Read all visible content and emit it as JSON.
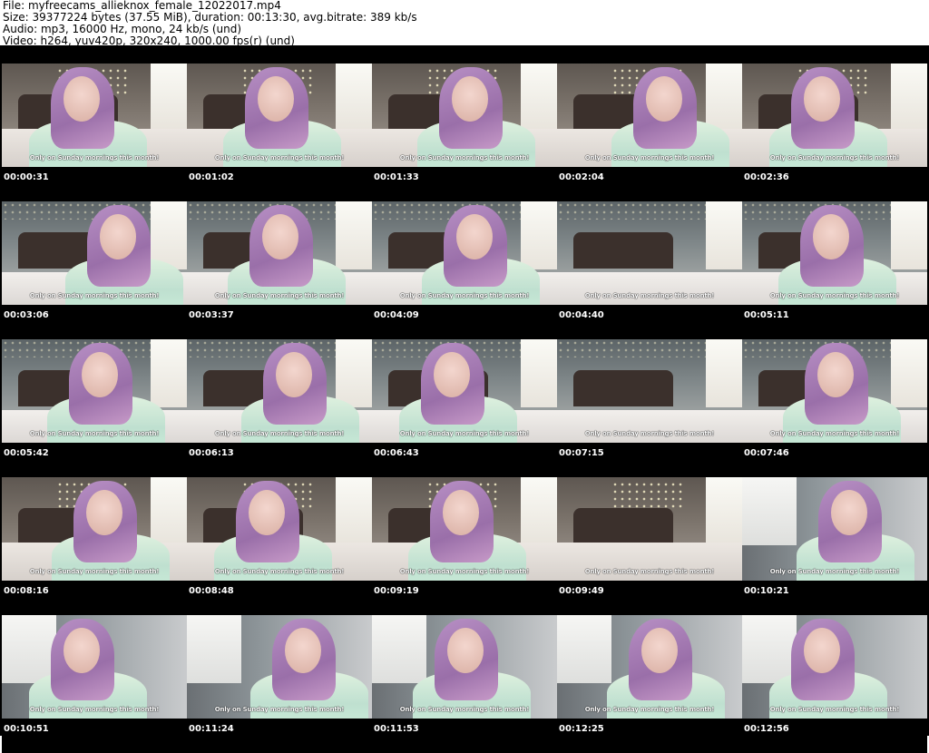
{
  "header": {
    "line1": "File: myfreecams_allieknox_female_12022017.mp4",
    "line2": "Size: 39377224 bytes (37.55 MiB), duration: 00:13:30, avg.bitrate: 389 kb/s",
    "line3": "Audio: mp3, 16000 Hz, mono, 24 kb/s (und)",
    "line4": "Video: h264, yuv420p, 320x240, 1000.00 fps(r) (und)"
  },
  "caption": "Only on Sunday mornings this month!",
  "thumbnails": [
    {
      "time": "00:00:31",
      "scene": "bedroom-a"
    },
    {
      "time": "00:01:02",
      "scene": "bedroom-a"
    },
    {
      "time": "00:01:33",
      "scene": "bedroom-a"
    },
    {
      "time": "00:02:04",
      "scene": "bedroom-a"
    },
    {
      "time": "00:02:36",
      "scene": "bedroom-a"
    },
    {
      "time": "00:03:06",
      "scene": "bedroom-b"
    },
    {
      "time": "00:03:37",
      "scene": "bedroom-b"
    },
    {
      "time": "00:04:09",
      "scene": "bedroom-b"
    },
    {
      "time": "00:04:40",
      "scene": "bedroom-b"
    },
    {
      "time": "00:05:11",
      "scene": "bedroom-b"
    },
    {
      "time": "00:05:42",
      "scene": "bedroom-b"
    },
    {
      "time": "00:06:13",
      "scene": "bedroom-b"
    },
    {
      "time": "00:06:43",
      "scene": "bedroom-b"
    },
    {
      "time": "00:07:15",
      "scene": "bedroom-b"
    },
    {
      "time": "00:07:46",
      "scene": "bedroom-b"
    },
    {
      "time": "00:08:16",
      "scene": "bedroom-a"
    },
    {
      "time": "00:08:48",
      "scene": "bedroom-a"
    },
    {
      "time": "00:09:19",
      "scene": "bedroom-a"
    },
    {
      "time": "00:09:49",
      "scene": "bedroom-a"
    },
    {
      "time": "00:10:21",
      "scene": "room-c"
    },
    {
      "time": "00:10:51",
      "scene": "room-c"
    },
    {
      "time": "00:11:24",
      "scene": "room-c"
    },
    {
      "time": "00:11:53",
      "scene": "room-c"
    },
    {
      "time": "00:12:25",
      "scene": "room-c"
    },
    {
      "time": "00:12:56",
      "scene": "room-c"
    }
  ]
}
